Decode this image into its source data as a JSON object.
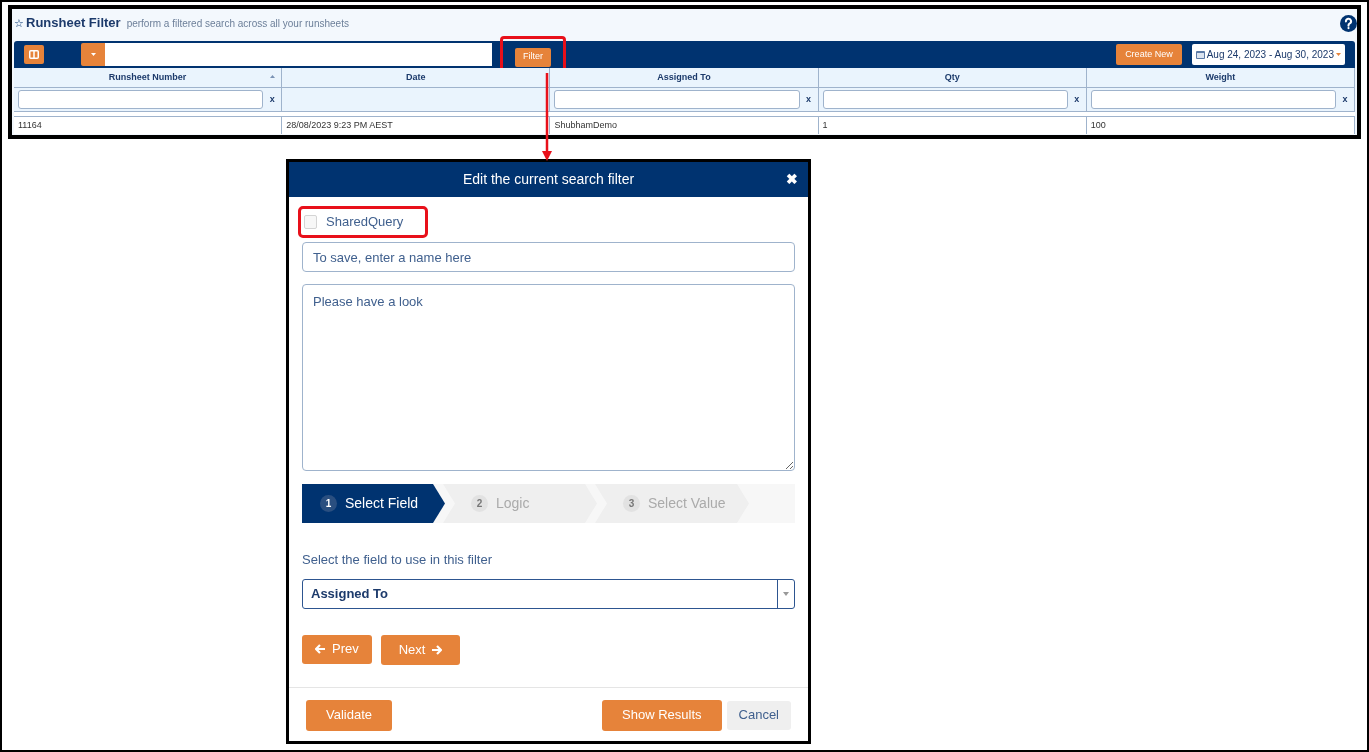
{
  "header": {
    "star": "☆",
    "title": "Runsheet Filter",
    "subtitle": "perform a filtered search across all your runsheets"
  },
  "toolbar": {
    "filter_button": "Filter",
    "create_button": "Create New",
    "date_range": "Aug 24, 2023 - Aug 30, 2023"
  },
  "table": {
    "columns": [
      {
        "label": "Runsheet Number",
        "sorted": true,
        "kind": "input",
        "clear": "x"
      },
      {
        "label": "Date",
        "sorted": false,
        "kind": "none"
      },
      {
        "label": "Assigned To",
        "sorted": false,
        "kind": "input",
        "clear": "x"
      },
      {
        "label": "Qty",
        "sorted": false,
        "kind": "input",
        "clear": "x"
      },
      {
        "label": "Weight",
        "sorted": false,
        "kind": "input",
        "clear": "x"
      }
    ],
    "rows": [
      [
        "11164",
        "28/08/2023 9:23 PM AEST",
        "ShubhamDemo",
        "1",
        "100"
      ]
    ]
  },
  "dialog": {
    "title": "Edit the current search filter",
    "close": "✖",
    "shared_query": {
      "label": "SharedQuery",
      "checked": false
    },
    "name_field": {
      "placeholder": "To save, enter a name here"
    },
    "notes": {
      "value": "Please have a look"
    },
    "steps": [
      {
        "number": "1",
        "label": "Select Field",
        "selected": true
      },
      {
        "number": "2",
        "label": "Logic",
        "selected": false
      },
      {
        "number": "3",
        "label": "Select Value",
        "selected": false
      }
    ],
    "field_label": "Select the field to use in this filter",
    "field_select": {
      "value": "Assigned To"
    },
    "prev_button": "Prev",
    "next_button": "Next",
    "validate_button": "Validate",
    "results_button": "Show Results",
    "cancel_button": "Cancel"
  }
}
